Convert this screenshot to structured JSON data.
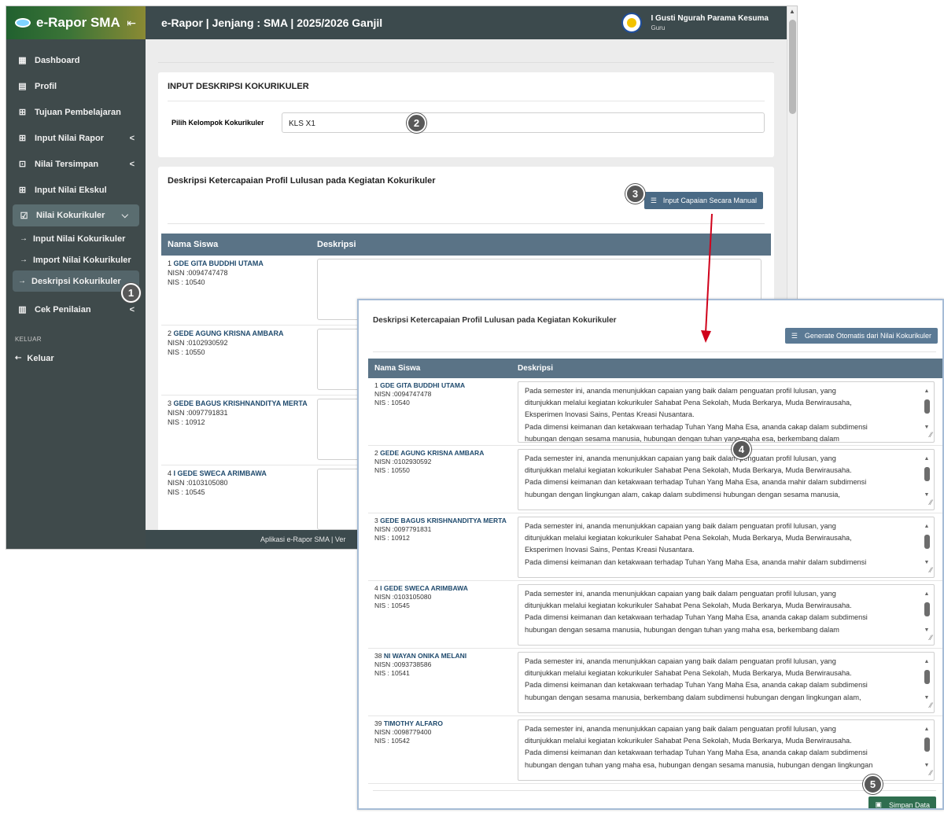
{
  "app": {
    "name": "e-Rapor SMA",
    "collapse_icon": "collapse-icon"
  },
  "topbar": {
    "title": "e-Rapor | Jenjang : SMA | 2025/2026 Ganjil",
    "user_name": "I Gusti Ngurah Parama Kesuma",
    "user_role": "Guru"
  },
  "sidebar": {
    "items": [
      {
        "label": "Dashboard",
        "icon": "dashboard-icon"
      },
      {
        "label": "Profil",
        "icon": "id-card-icon"
      },
      {
        "label": "Tujuan Pembelajaran",
        "icon": "plus-box-icon"
      },
      {
        "label": "Input Nilai Rapor",
        "icon": "plus-square-icon",
        "chevron": "<"
      },
      {
        "label": "Nilai Tersimpan",
        "icon": "download-box-icon",
        "chevron": "<"
      },
      {
        "label": "Input Nilai Ekskul",
        "icon": "plus-box-icon"
      },
      {
        "label": "Nilai Kokurikuler",
        "icon": "clipboard-check-icon",
        "chevron": "⌵"
      }
    ],
    "subitems": [
      "Input Nilai Kokurikuler",
      "Import Nilai Kokurikuler",
      "Deskripsi Kokurikuler"
    ],
    "cek": {
      "label": "Cek Penilaian",
      "chevron": "<"
    },
    "section": "KELUAR",
    "logout": "Keluar"
  },
  "card1": {
    "title": "INPUT DESKRIPSI KOKURIKULER",
    "label": "Pilih Kelompok Kokurikuler",
    "value": "KLS X1"
  },
  "card2": {
    "title": "Deskripsi Ketercapaian Profil Lulusan pada Kegiatan Kokurikuler",
    "button": "Input Capaian Secara Manual",
    "col1": "Nama Siswa",
    "col2": "Deskripsi",
    "students": [
      {
        "no": "1",
        "name": "GDE GITA BUDDHI UTAMA",
        "nisn": "NISN :0094747478",
        "nis": "NIS : 10540"
      },
      {
        "no": "2",
        "name": "GEDE AGUNG KRISNA AMBARA",
        "nisn": "NISN :0102930592",
        "nis": "NIS : 10550"
      },
      {
        "no": "3",
        "name": "GEDE BAGUS KRISHNANDITYA MERTA",
        "nisn": "NISN :0097791831",
        "nis": "NIS : 10912"
      },
      {
        "no": "4",
        "name": "I GEDE SWECA ARIMBAWA",
        "nisn": "NISN :0103105080",
        "nis": "NIS : 10545"
      }
    ]
  },
  "footer": {
    "text": "Aplikasi e-Rapor SMA | Ver"
  },
  "overlay": {
    "title": "Deskripsi Ketercapaian Profil Lulusan pada Kegiatan Kokurikuler",
    "button": "Generate Otomatis dari Nilai Kokurikuler",
    "col1": "Nama Siswa",
    "col2": "Deskripsi",
    "save": "Simpan Data",
    "rows": [
      {
        "no": "1",
        "name": "GDE GITA BUDDHI UTAMA",
        "nisn": "NISN :0094747478",
        "nis": "NIS : 10540",
        "lines": [
          "Pada semester ini, ananda menunjukkan capaian yang baik dalam penguatan profil lulusan, yang",
          "ditunjukkan melalui kegiatan kokurikuler  Sahabat Pena Sekolah, Muda Berkarya, Muda Berwirausaha,",
          "Eksperimen Inovasi Sains, Pentas Kreasi Nusantara.",
          "Pada dimensi keimanan dan ketakwaan terhadap Tuhan Yang Maha Esa, ananda  cakap dalam subdimensi",
          "hubungan dengan sesama manusia, hubungan dengan tuhan yang maha esa,  berkembang dalam"
        ]
      },
      {
        "no": "2",
        "name": "GEDE AGUNG KRISNA AMBARA",
        "nisn": "NISN :0102930592",
        "nis": "NIS : 10550",
        "lines": [
          "Pada semester ini, ananda menunjukkan capaian yang baik dalam penguatan profil lulusan, yang",
          "ditunjukkan melalui kegiatan kokurikuler  Sahabat Pena Sekolah, Muda Berkarya, Muda Berwirausaha.",
          "Pada dimensi keimanan dan ketakwaan terhadap Tuhan Yang Maha Esa, ananda  mahir dalam subdimensi",
          "hubungan dengan lingkungan alam,  cakap dalam subdimensi hubungan dengan sesama manusia,"
        ]
      },
      {
        "no": "3",
        "name": "GEDE BAGUS KRISHNANDITYA MERTA",
        "nisn": "NISN :0097791831",
        "nis": "NIS : 10912",
        "lines": [
          "Pada semester ini, ananda menunjukkan capaian yang baik dalam penguatan profil lulusan, yang",
          "ditunjukkan melalui kegiatan kokurikuler  Sahabat Pena Sekolah, Muda Berkarya, Muda Berwirausaha,",
          "Eksperimen Inovasi Sains, Pentas Kreasi Nusantara.",
          "Pada dimensi keimanan dan ketakwaan terhadap Tuhan Yang Maha Esa, ananda  mahir dalam subdimensi"
        ]
      },
      {
        "no": "4",
        "name": "I GEDE SWECA ARIMBAWA",
        "nisn": "NISN :0103105080",
        "nis": "NIS : 10545",
        "lines": [
          "Pada semester ini, ananda menunjukkan capaian yang baik dalam penguatan profil lulusan, yang",
          "ditunjukkan melalui kegiatan kokurikuler  Sahabat Pena Sekolah, Muda Berkarya, Muda Berwirausaha.",
          "Pada dimensi keimanan dan ketakwaan terhadap Tuhan Yang Maha Esa, ananda  cakap dalam subdimensi",
          "hubungan dengan sesama manusia, hubungan dengan tuhan yang maha esa,  berkembang dalam"
        ]
      },
      {
        "no": "38",
        "name": "NI WAYAN ONIKA MELANI",
        "nisn": "NISN :0093738586",
        "nis": "NIS : 10541",
        "lines": [
          "Pada semester ini, ananda menunjukkan capaian yang baik dalam penguatan profil lulusan, yang",
          "ditunjukkan melalui kegiatan kokurikuler  Sahabat Pena Sekolah, Muda Berkarya, Muda Berwirausaha.",
          "Pada dimensi keimanan dan ketakwaan terhadap Tuhan Yang Maha Esa, ananda  cakap dalam subdimensi",
          "hubungan dengan sesama manusia,  berkembang dalam subdimensi hubungan dengan lingkungan alam,"
        ]
      },
      {
        "no": "39",
        "name": "TIMOTHY ALFARO",
        "nisn": "NISN :0098779400",
        "nis": "NIS : 10542",
        "lines": [
          "Pada semester ini, ananda menunjukkan capaian yang baik dalam penguatan profil lulusan, yang",
          "ditunjukkan melalui kegiatan kokurikuler  Sahabat Pena Sekolah, Muda Berkarya, Muda Berwirausaha.",
          "Pada dimensi keimanan dan ketakwaan terhadap Tuhan Yang Maha Esa, ananda  cakap dalam subdimensi",
          "hubungan dengan tuhan yang maha esa, hubungan dengan sesama manusia, hubungan dengan lingkungan"
        ]
      }
    ]
  },
  "markers": [
    "1",
    "2",
    "3",
    "4",
    "5"
  ],
  "colors": {
    "sidebar": "#3f4a4b",
    "header": "#5a7386",
    "accent_button": "#4a6a85",
    "save_button": "#2f6e4f",
    "arrow": "#d0021b"
  }
}
